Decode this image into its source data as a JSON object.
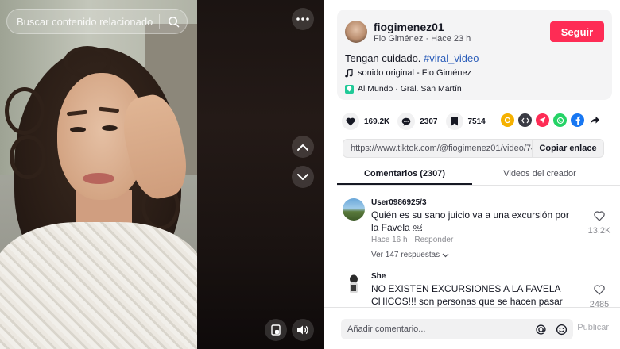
{
  "video": {
    "search": {
      "placeholder": "Buscar contenido relacionado"
    }
  },
  "author": {
    "username": "fiogimenez01",
    "display_name": "Fio Giménez",
    "time_ago": "Hace 23 h",
    "follow_label": "Seguir"
  },
  "post": {
    "caption_text": "Tengan cuidado.",
    "hashtag": "#viral_video",
    "music": "sonido original - Fio Giménez",
    "location": "Al Mundo · Gral. San Martín"
  },
  "stats": {
    "likes": "169.2K",
    "comments": "2307",
    "saves": "7514"
  },
  "share": {
    "icons": [
      "embed-like-icon",
      "code-icon",
      "send-icon",
      "whatsapp-icon",
      "facebook-icon",
      "forward-icon"
    ],
    "colors": {
      "orange": "#f5b100",
      "dark": "#3a3b44",
      "red": "#fe2c55",
      "whatsapp": "#25d366",
      "facebook": "#1877f2"
    }
  },
  "link": {
    "url": "https://www.tiktok.com/@fiogimenez01/video/74...",
    "copy_label": "Copiar enlace"
  },
  "tabs": [
    {
      "label": "Comentarios (2307)"
    },
    {
      "label": "Videos del creador"
    }
  ],
  "comments": [
    {
      "user": "User0986925/3",
      "text": "Quién es su sano juicio va a una excursión por la Favela ￼",
      "time": "Hace 16 h",
      "reply_label": "Responder",
      "likes": "13.2K",
      "view_replies": "Ver 147 respuestas"
    },
    {
      "user": "She",
      "text": "NO EXISTEN EXCURSIONES A LA FAVELA CHICOS!!! son personas que se hacen pasar por",
      "likes": "2485"
    }
  ],
  "composer": {
    "placeholder": "Añadir comentario...",
    "post_label": "Publicar"
  },
  "colors": {
    "accent": "#fe2c55",
    "hashtag": "#2b5db9"
  }
}
